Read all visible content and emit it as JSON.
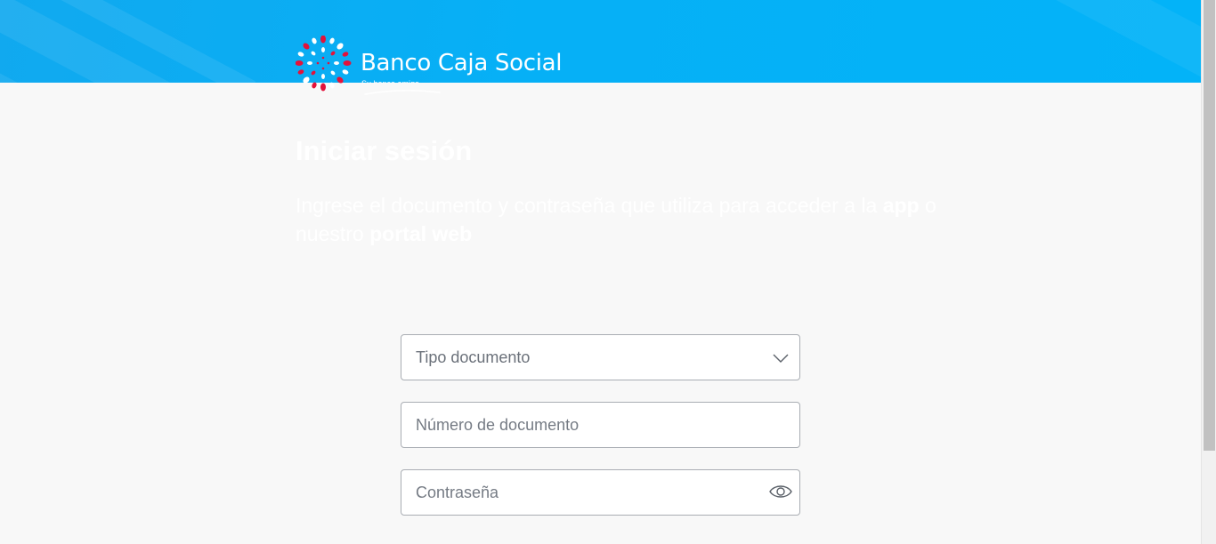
{
  "brand": {
    "name": "Banco Caja Social",
    "tagline": "Su banco amigo",
    "header_color": "#06b0f6"
  },
  "hero": {
    "title": "Iniciar sesión",
    "subtitle_part1": "Ingrese el documento y contraseña que utiliza para acceder a la ",
    "subtitle_bold1": "app",
    "subtitle_part2": " o nuestro ",
    "subtitle_bold2": "portal web"
  },
  "form": {
    "document_type": {
      "placeholder": "Tipo documento",
      "icon": "chevron-down-icon"
    },
    "document_number": {
      "placeholder": "Número de documento",
      "value": ""
    },
    "password": {
      "placeholder": "Contraseña",
      "value": "",
      "icon": "eye-icon"
    }
  }
}
